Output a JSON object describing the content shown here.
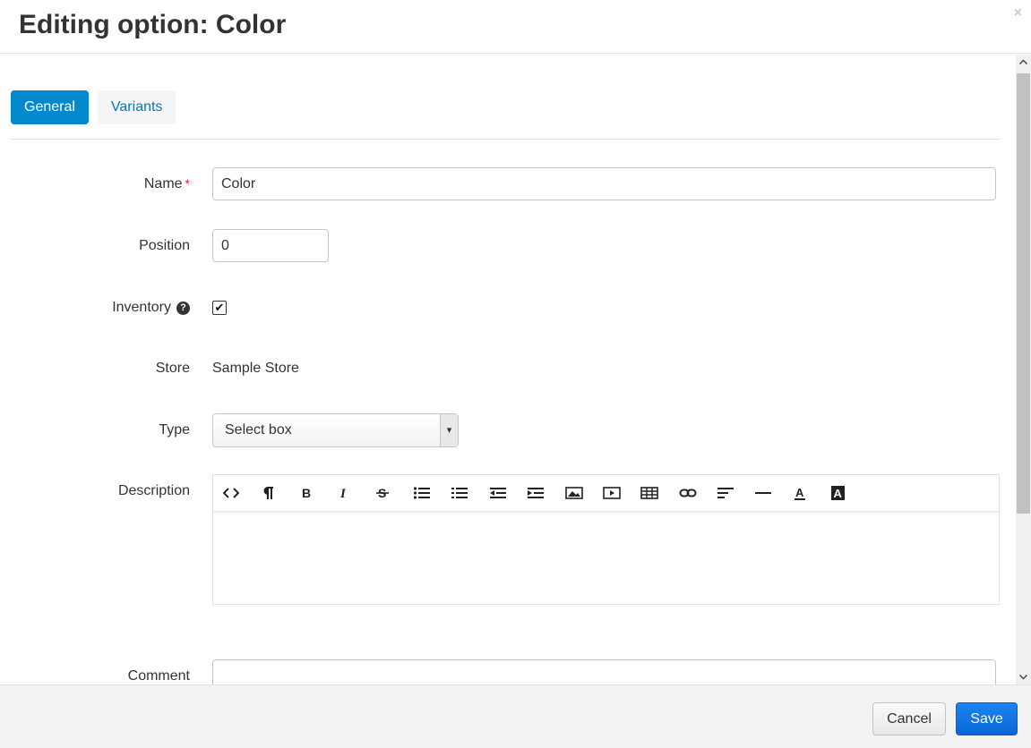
{
  "dialog": {
    "title": "Editing option: Color",
    "close_glyph": "×"
  },
  "tabs": [
    {
      "label": "General",
      "active": true
    },
    {
      "label": "Variants",
      "active": false
    }
  ],
  "form": {
    "name": {
      "label": "Name",
      "required_mark": "*",
      "value": "Color"
    },
    "position": {
      "label": "Position",
      "value": "0"
    },
    "inventory": {
      "label": "Inventory",
      "help_glyph": "?",
      "checked": true,
      "check_glyph": "✔"
    },
    "store": {
      "label": "Store",
      "value": "Sample Store"
    },
    "type": {
      "label": "Type",
      "selected": "Select box",
      "arrow_glyph": "▾"
    },
    "description": {
      "label": "Description",
      "toolbar": [
        "html-code-icon",
        "paragraph-icon",
        "bold-icon",
        "italic-icon",
        "strikethrough-icon",
        "unordered-list-icon",
        "ordered-list-icon",
        "outdent-icon",
        "indent-icon",
        "image-icon",
        "video-icon",
        "table-icon",
        "link-icon",
        "align-icon",
        "horizontal-rule-icon",
        "font-color-icon",
        "background-color-icon"
      ],
      "value": ""
    },
    "comment": {
      "label": "Comment",
      "value": ""
    }
  },
  "footer": {
    "cancel_label": "Cancel",
    "save_label": "Save"
  },
  "colors": {
    "accent": "#0388cc",
    "save": "#0a66d8",
    "required": "#e2202c"
  }
}
